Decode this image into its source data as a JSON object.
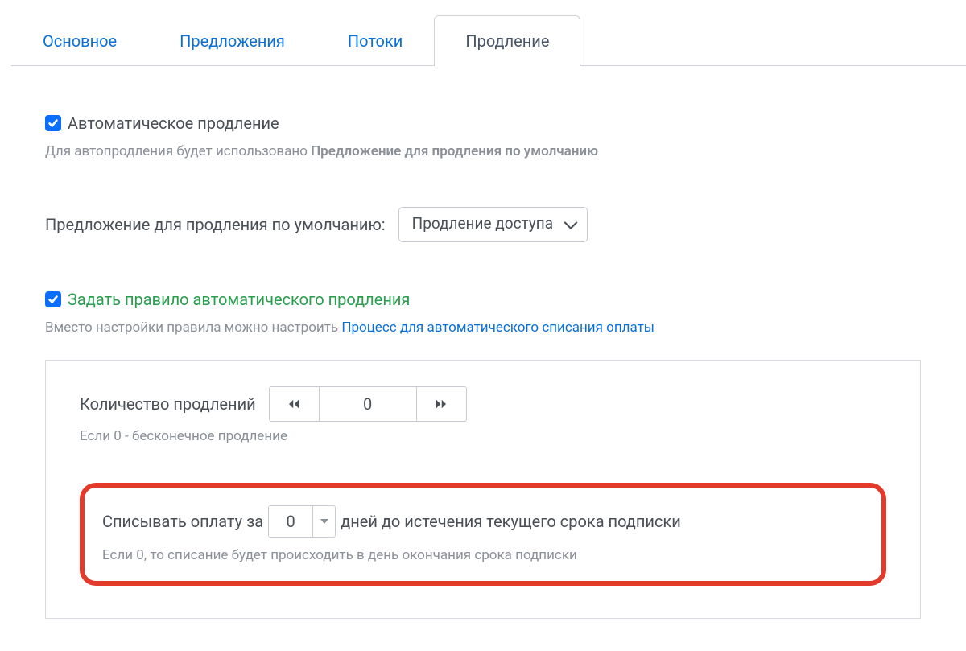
{
  "tabs": [
    {
      "label": "Основное",
      "active": false
    },
    {
      "label": "Предложения",
      "active": false
    },
    {
      "label": "Потоки",
      "active": false
    },
    {
      "label": "Продление",
      "active": true
    }
  ],
  "autoRenew": {
    "checkbox_label": "Автоматическое продление",
    "hint_prefix": "Для автопродления будет использовано ",
    "hint_bold": "Предложение для продления по умолчанию",
    "checked": true
  },
  "defaultOffer": {
    "label": "Предложение для продления по умолчанию:",
    "selected": "Продление доступа"
  },
  "ruleCheckbox": {
    "label": "Задать правило автоматического продления",
    "hint_prefix": "Вместо настройки правила можно настроить ",
    "hint_link": "Процесс для автоматического списания оплаты",
    "checked": true
  },
  "renewCount": {
    "label": "Количество продлений",
    "value": "0",
    "hint": "Если 0 - бесконечное продление"
  },
  "chargeBefore": {
    "prefix": "Списывать оплату за",
    "value": "0",
    "suffix": "дней до истечения текущего срока подписки",
    "hint": "Если 0, то списание будет происходить в день окончания срока подписки"
  }
}
